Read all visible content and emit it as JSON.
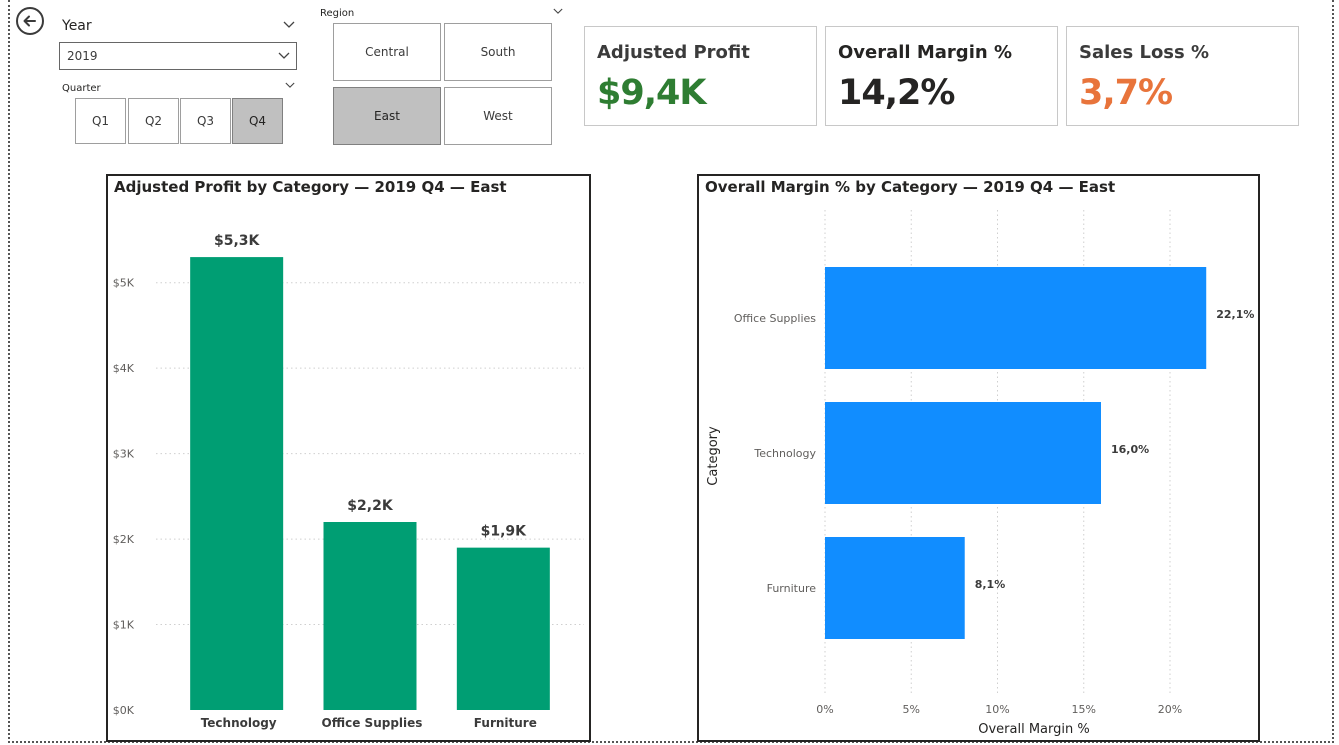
{
  "filters": {
    "year": {
      "title": "Year",
      "selected": "2019"
    },
    "quarter": {
      "title": "Quarter",
      "options": [
        "Q1",
        "Q2",
        "Q3",
        "Q4"
      ],
      "selected": "Q4"
    },
    "region": {
      "title": "Region",
      "options": [
        "Central",
        "South",
        "East",
        "West"
      ],
      "selected": "East"
    }
  },
  "kpis": [
    {
      "label": "Adjusted Profit",
      "value": "$9,4K",
      "color": "#2e7d32"
    },
    {
      "label": "Overall Margin %",
      "value": "14,2%",
      "color": "#252423"
    },
    {
      "label": "Sales Loss %",
      "value": "3,7%",
      "color": "#e8743b"
    }
  ],
  "chart_data": [
    {
      "type": "bar",
      "title": "Adjusted Profit by Category — 2019 Q4 — East",
      "categories": [
        "Technology",
        "Office Supplies",
        "Furniture"
      ],
      "values": [
        5.3,
        2.2,
        1.9
      ],
      "data_labels": [
        "$5,3K",
        "$2,2K",
        "$1,9K"
      ],
      "y_ticks": [
        "$0K",
        "$1K",
        "$2K",
        "$3K",
        "$4K",
        "$5K"
      ],
      "ylim": [
        0,
        5.5
      ],
      "color": "#009e73",
      "grid": true
    },
    {
      "type": "bar",
      "orientation": "horizontal",
      "title": "Overall Margin % by Category — 2019 Q4 — East",
      "categories": [
        "Office Supplies",
        "Technology",
        "Furniture"
      ],
      "values": [
        22.1,
        16.0,
        8.1
      ],
      "data_labels": [
        "22,1%",
        "16,0%",
        "8,1%"
      ],
      "x_ticks": [
        "0%",
        "5%",
        "10%",
        "15%",
        "20%"
      ],
      "xlim": [
        0,
        24
      ],
      "xlabel": "Overall Margin %",
      "ylabel": "Category",
      "color": "#118dff",
      "grid": true
    }
  ]
}
